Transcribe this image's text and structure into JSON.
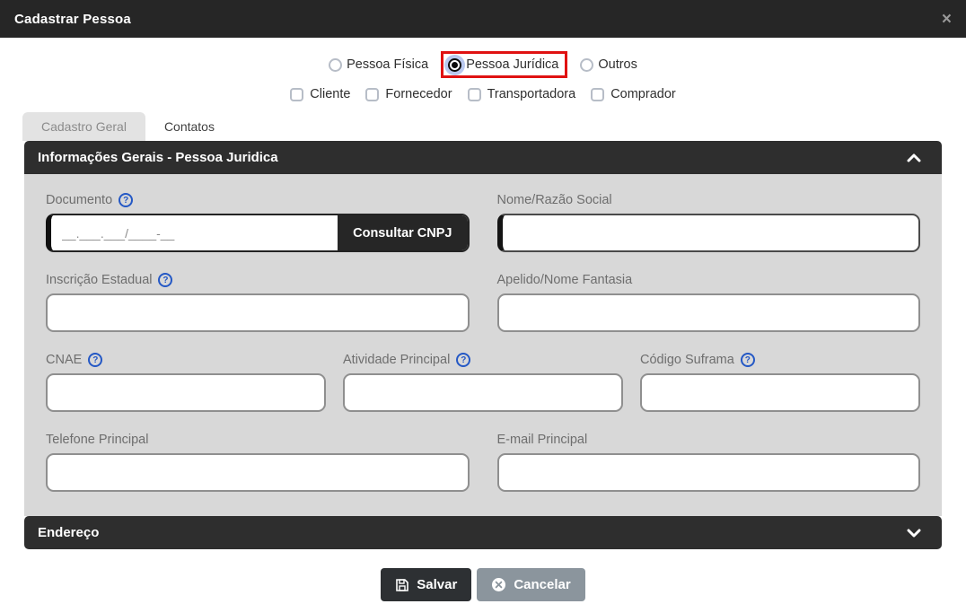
{
  "modal": {
    "title": "Cadastrar Pessoa",
    "close_icon": "×"
  },
  "icons": {
    "help": "?"
  },
  "person_type": {
    "options": [
      {
        "label": "Pessoa Física",
        "selected": false
      },
      {
        "label": "Pessoa Jurídica",
        "selected": true,
        "highlighted": true
      },
      {
        "label": "Outros",
        "selected": false
      }
    ]
  },
  "roles": {
    "options": [
      {
        "label": "Cliente",
        "checked": false
      },
      {
        "label": "Fornecedor",
        "checked": false
      },
      {
        "label": "Transportadora",
        "checked": false
      },
      {
        "label": "Comprador",
        "checked": false
      }
    ]
  },
  "tabs": [
    {
      "label": "Cadastro Geral",
      "active": true
    },
    {
      "label": "Contatos",
      "active": false
    }
  ],
  "sections": {
    "general": {
      "title": "Informações Gerais - Pessoa Juridica",
      "expanded": true
    },
    "address": {
      "title": "Endereço",
      "expanded": false
    }
  },
  "form": {
    "documento": {
      "label": "Documento",
      "value": "",
      "mask": "__.___.___/____-__",
      "button_label": "Consultar CNPJ",
      "has_help": true
    },
    "nome_razao": {
      "label": "Nome/Razão Social",
      "value": ""
    },
    "inscricao_estadual": {
      "label": "Inscrição Estadual",
      "value": "",
      "has_help": true
    },
    "apelido_fantasia": {
      "label": "Apelido/Nome Fantasia",
      "value": ""
    },
    "cnae": {
      "label": "CNAE",
      "value": "",
      "has_help": true
    },
    "atividade_principal": {
      "label": "Atividade Principal",
      "value": "",
      "has_help": true
    },
    "codigo_suframa": {
      "label": "Código Suframa",
      "value": "",
      "has_help": true
    },
    "telefone": {
      "label": "Telefone Principal",
      "value": ""
    },
    "email": {
      "label": "E-mail Principal",
      "value": ""
    }
  },
  "footer": {
    "save_label": "Salvar",
    "cancel_label": "Cancelar"
  },
  "colors": {
    "header_bg": "#262626",
    "section_header_bg": "#2e2e2e",
    "panel_bg": "#d8d8d8",
    "highlight_red": "#e01212",
    "help_blue": "#2458c5",
    "save_bg": "#2d3033",
    "cancel_bg": "#8b959d"
  }
}
